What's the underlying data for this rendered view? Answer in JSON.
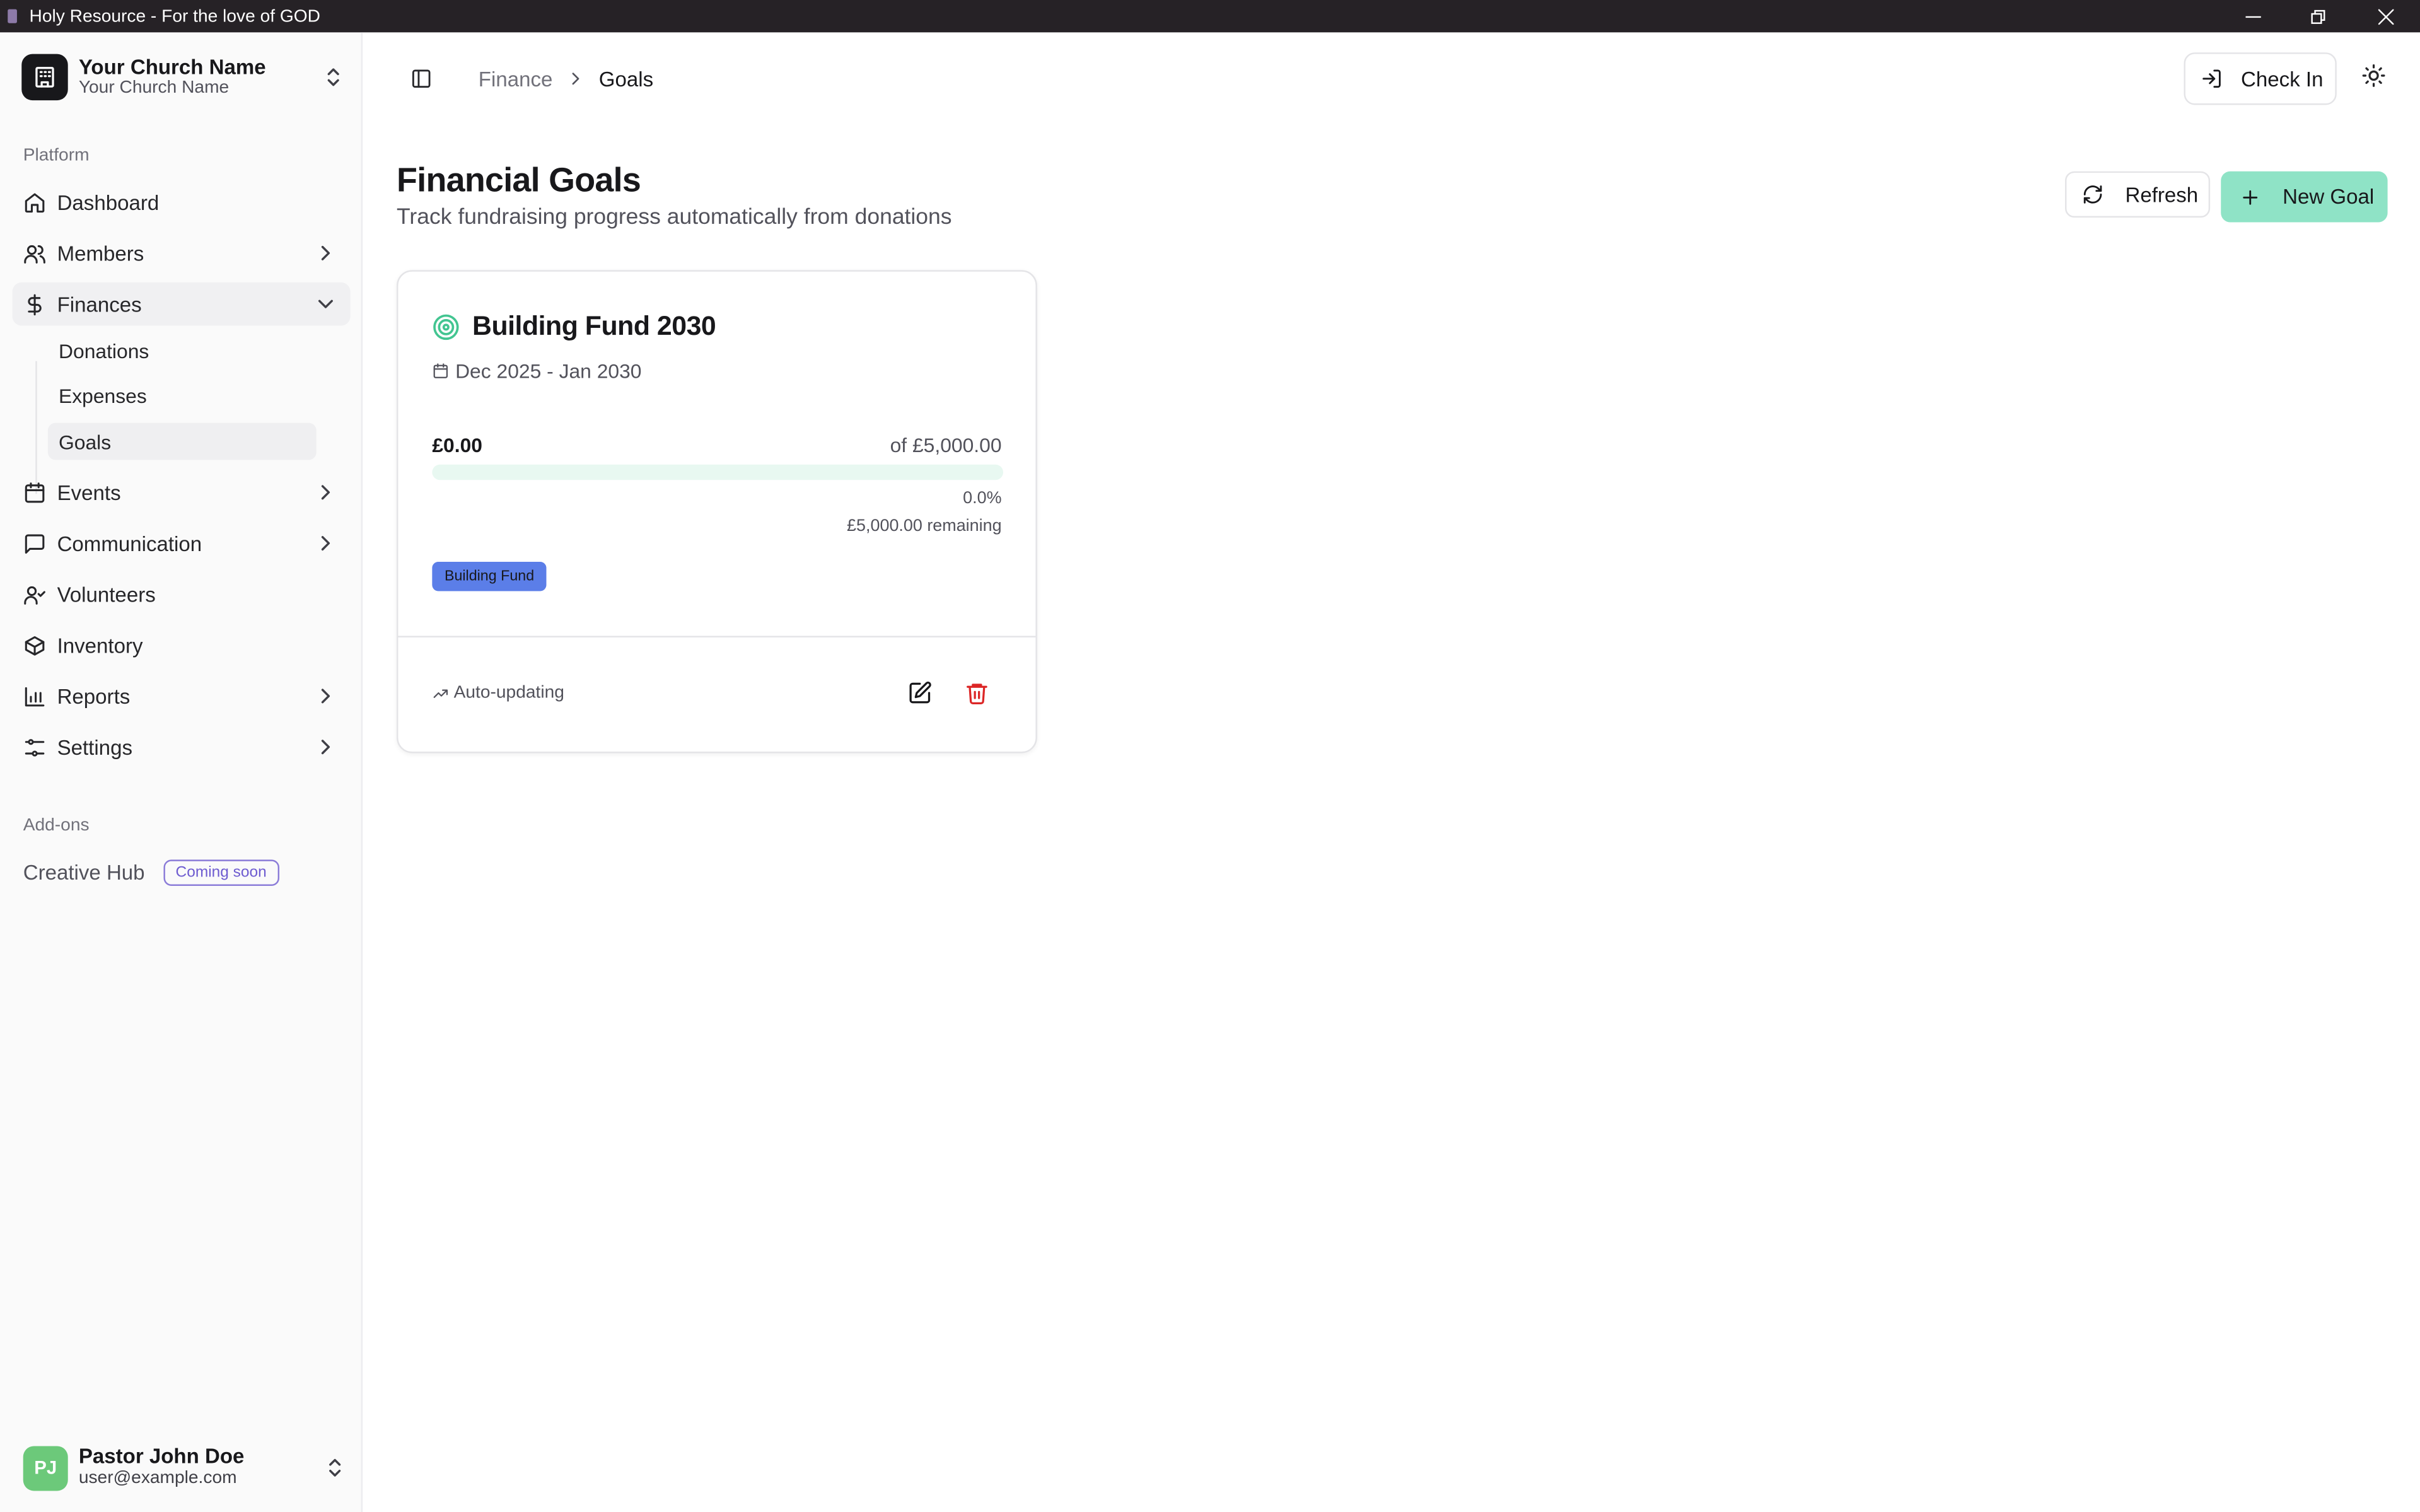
{
  "window": {
    "title": "Holy Resource - For the love of GOD",
    "controls": [
      "minimize",
      "restore",
      "close"
    ]
  },
  "sidebar": {
    "org": {
      "name": "Your Church Name",
      "subtitle": "Your Church Name"
    },
    "platform_label": "Platform",
    "items": [
      {
        "label": "Dashboard",
        "icon": "home-icon",
        "has_chevron": false
      },
      {
        "label": "Members",
        "icon": "users-icon",
        "has_chevron": true
      },
      {
        "label": "Finances",
        "icon": "dollar-icon",
        "expanded": true
      },
      {
        "label": "Events",
        "icon": "calendar-icon",
        "has_chevron": true
      },
      {
        "label": "Communication",
        "icon": "message-icon",
        "has_chevron": true
      },
      {
        "label": "Volunteers",
        "icon": "user-check-icon",
        "has_chevron": false
      },
      {
        "label": "Inventory",
        "icon": "package-icon",
        "has_chevron": false
      },
      {
        "label": "Reports",
        "icon": "bar-chart-icon",
        "has_chevron": true
      },
      {
        "label": "Settings",
        "icon": "sliders-icon",
        "has_chevron": true
      }
    ],
    "finance_sub": [
      {
        "label": "Donations"
      },
      {
        "label": "Expenses"
      },
      {
        "label": "Goals",
        "active": true
      }
    ],
    "addons_label": "Add-ons",
    "creative_hub": {
      "label": "Creative Hub",
      "badge": "Coming soon"
    },
    "user": {
      "initials": "PJ",
      "name": "Pastor John Doe",
      "email": "user@example.com"
    }
  },
  "header": {
    "breadcrumb": [
      "Finance",
      "Goals"
    ],
    "check_in_label": "Check In"
  },
  "page": {
    "title": "Financial Goals",
    "subtitle": "Track fundraising progress automatically from donations",
    "refresh_label": "Refresh",
    "new_goal_label": "New Goal"
  },
  "goals": [
    {
      "name": "Building Fund 2030",
      "date_range": "Dec 2025 - Jan 2030",
      "current": "£0.00",
      "target": "of £5,000.00",
      "progress_fraction": 0.0,
      "percent_label": "0.0%",
      "remaining": "£5,000.00 remaining",
      "tag": "Building Fund",
      "status": "Auto-updating"
    }
  ],
  "colors": {
    "accent": "#8fe3c6",
    "progress_track": "#e8f8f1",
    "tag": "#5b7ee8",
    "delete": "#dc2626",
    "titlebar": "#262226"
  }
}
